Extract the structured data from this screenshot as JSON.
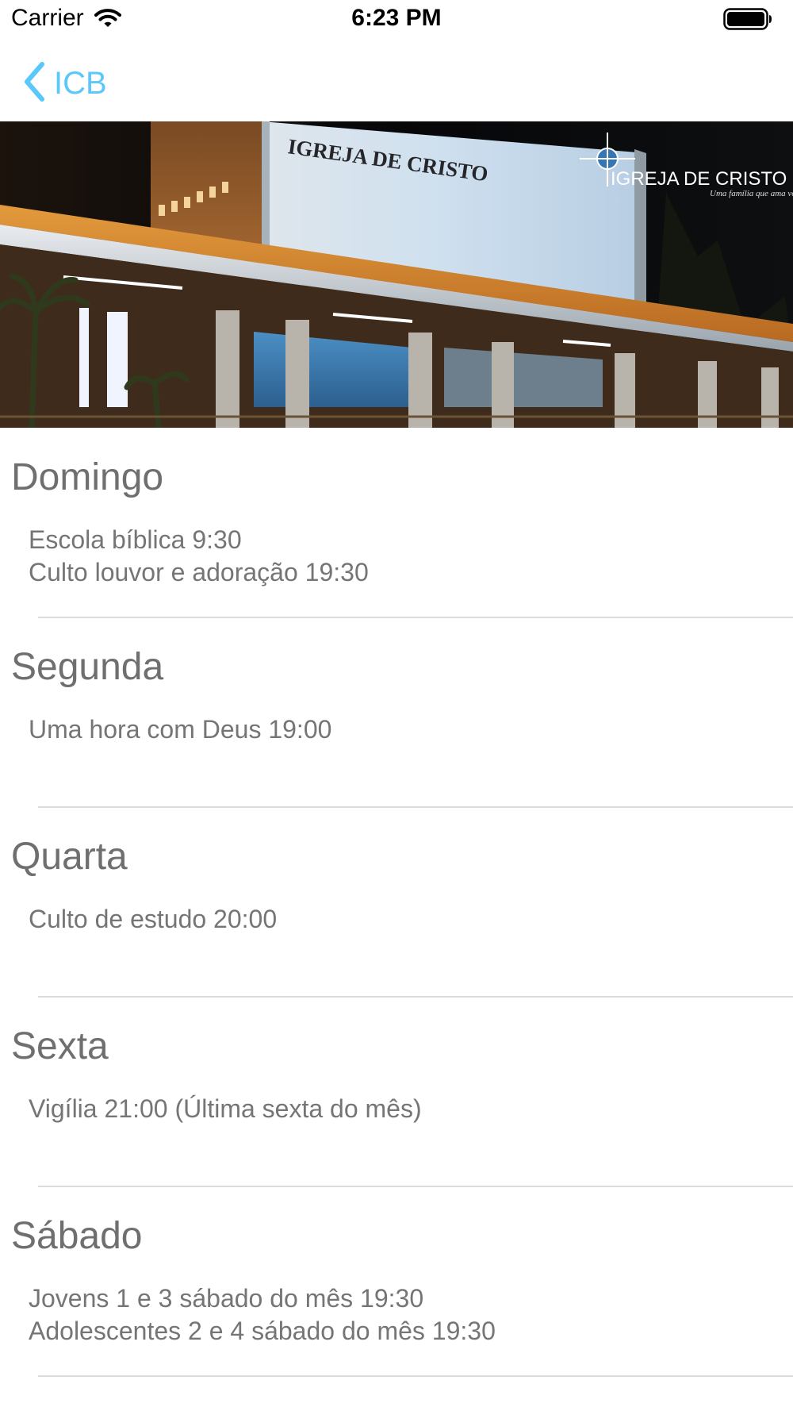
{
  "status_bar": {
    "carrier": "Carrier",
    "time": "6:23 PM"
  },
  "nav": {
    "back_label": "ICB"
  },
  "banner": {
    "building_sign": "IGREJA DE CRISTO",
    "logo_name": "IGREJA DE CRISTO",
    "logo_tagline": "Uma família que ama você"
  },
  "schedule": [
    {
      "day": "Domingo",
      "events": [
        "Escola bíblica 9:30",
        "Culto louvor e adoração 19:30"
      ]
    },
    {
      "day": "Segunda",
      "events": [
        "Uma hora com Deus 19:00"
      ]
    },
    {
      "day": "Quarta",
      "events": [
        "Culto de estudo 20:00"
      ]
    },
    {
      "day": "Sexta",
      "events": [
        "Vigília 21:00 (Última sexta do mês)"
      ]
    },
    {
      "day": "Sábado",
      "events": [
        "Jovens 1 e 3 sábado do mês 19:30",
        "Adolescentes 2 e 4 sábado do mês 19:30"
      ]
    }
  ],
  "colors": {
    "accent": "#5ac8fa",
    "day_title": "#6f6f6f",
    "event_text": "#757575",
    "separator": "#dcdcdc"
  },
  "icons": {
    "back": "chevron-left-icon",
    "wifi": "wifi-icon",
    "battery": "battery-icon"
  }
}
